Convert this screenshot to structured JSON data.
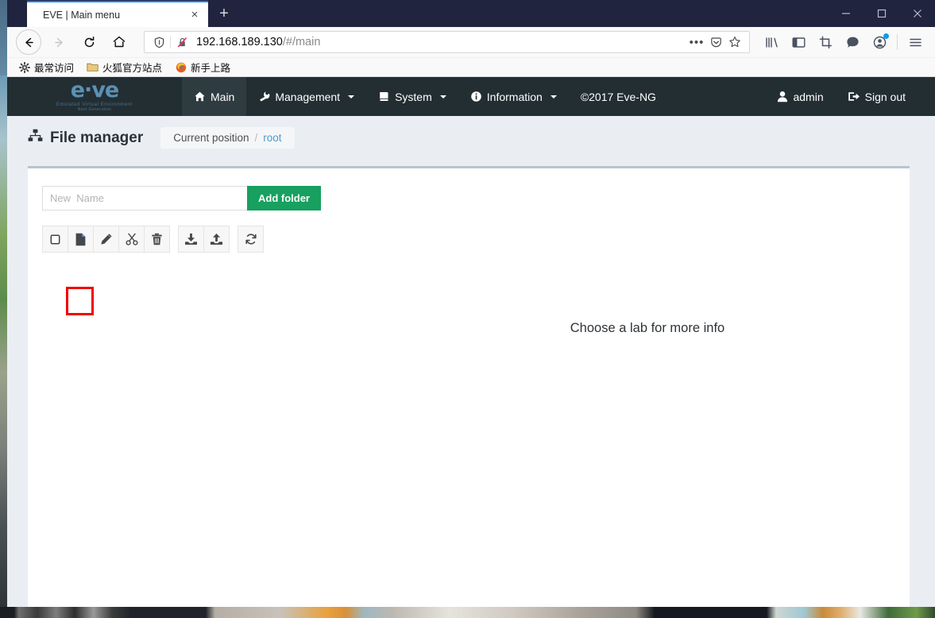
{
  "browser": {
    "tab": {
      "title": "EVE | Main menu",
      "close_label": "×",
      "icon": "close-icon"
    },
    "new_tab_label": "+",
    "window_controls": {
      "minimize": "—",
      "maximize": "□",
      "close": "✕"
    },
    "nav": {
      "back": "back-arrow-icon",
      "forward": "forward-arrow-icon",
      "reload": "reload-icon",
      "home": "home-icon"
    },
    "urlbar": {
      "shield_icon": "shield-icon",
      "security_icon": "broken-lock-icon",
      "url_host": "192.168.189.130",
      "url_path": "/#/main",
      "page_actions_label": "•••",
      "pocket_icon": "pocket-icon",
      "bookmark_icon": "star-icon"
    },
    "toolbar_icons": [
      {
        "name": "library-icon"
      },
      {
        "name": "sidebar-icon"
      },
      {
        "name": "screenshot-icon"
      },
      {
        "name": "messenger-icon"
      },
      {
        "name": "account-icon",
        "badge": true
      },
      {
        "name": "hamburger-menu-icon"
      }
    ],
    "bookmarks": [
      {
        "label": "最常访问",
        "icon": "gear-icon"
      },
      {
        "label": "火狐官方站点",
        "icon": "folder-icon"
      },
      {
        "label": "新手上路",
        "icon": "firefox-icon"
      }
    ]
  },
  "eve": {
    "logo": {
      "text": "e·ve",
      "subtitle1": "Emulated Virtual Environment",
      "subtitle2": "Next Generation"
    },
    "nav_items": [
      {
        "label": "Main",
        "icon": "home-icon",
        "active": true,
        "caret": false
      },
      {
        "label": "Management",
        "icon": "wrench-icon",
        "active": false,
        "caret": true
      },
      {
        "label": "System",
        "icon": "book-icon",
        "active": false,
        "caret": true
      },
      {
        "label": "Information",
        "icon": "info-circle-icon",
        "active": false,
        "caret": true
      }
    ],
    "copyright": "©2017 Eve-NG",
    "user": {
      "label": "admin",
      "icon": "user-icon"
    },
    "signout": {
      "label": "Sign out",
      "icon": "signout-icon"
    }
  },
  "page_header": {
    "title": "File manager",
    "title_icon": "sitemap-icon",
    "breadcrumb": {
      "current_label": "Current position",
      "separator": "/",
      "path": "root"
    }
  },
  "file_manager": {
    "new_name": {
      "value": "",
      "placeholder": "New  Name"
    },
    "add_folder_label": "Add folder",
    "toolbar_groups": [
      {
        "buttons": [
          {
            "name": "select-all-checkbox",
            "icon": "checkbox-icon",
            "highlighted": false
          },
          {
            "name": "new-file-button",
            "icon": "file-icon",
            "highlighted": true
          },
          {
            "name": "rename-button",
            "icon": "pencil-icon",
            "highlighted": false
          },
          {
            "name": "cut-button",
            "icon": "scissors-icon",
            "highlighted": false
          },
          {
            "name": "delete-button",
            "icon": "trash-icon",
            "highlighted": false
          }
        ]
      },
      {
        "buttons": [
          {
            "name": "download-button",
            "icon": "download-icon",
            "highlighted": false
          },
          {
            "name": "upload-button",
            "icon": "upload-icon",
            "highlighted": false
          }
        ]
      },
      {
        "buttons": [
          {
            "name": "refresh-button",
            "icon": "refresh-icon",
            "highlighted": false
          }
        ]
      }
    ],
    "empty_hint": "Choose a lab for more info"
  },
  "colors": {
    "navbar_bg": "#232e33",
    "accent_green": "#17a05f",
    "highlight_red": "#f20000",
    "link_blue": "#4a9fd1",
    "page_bg": "#eaeef2"
  }
}
